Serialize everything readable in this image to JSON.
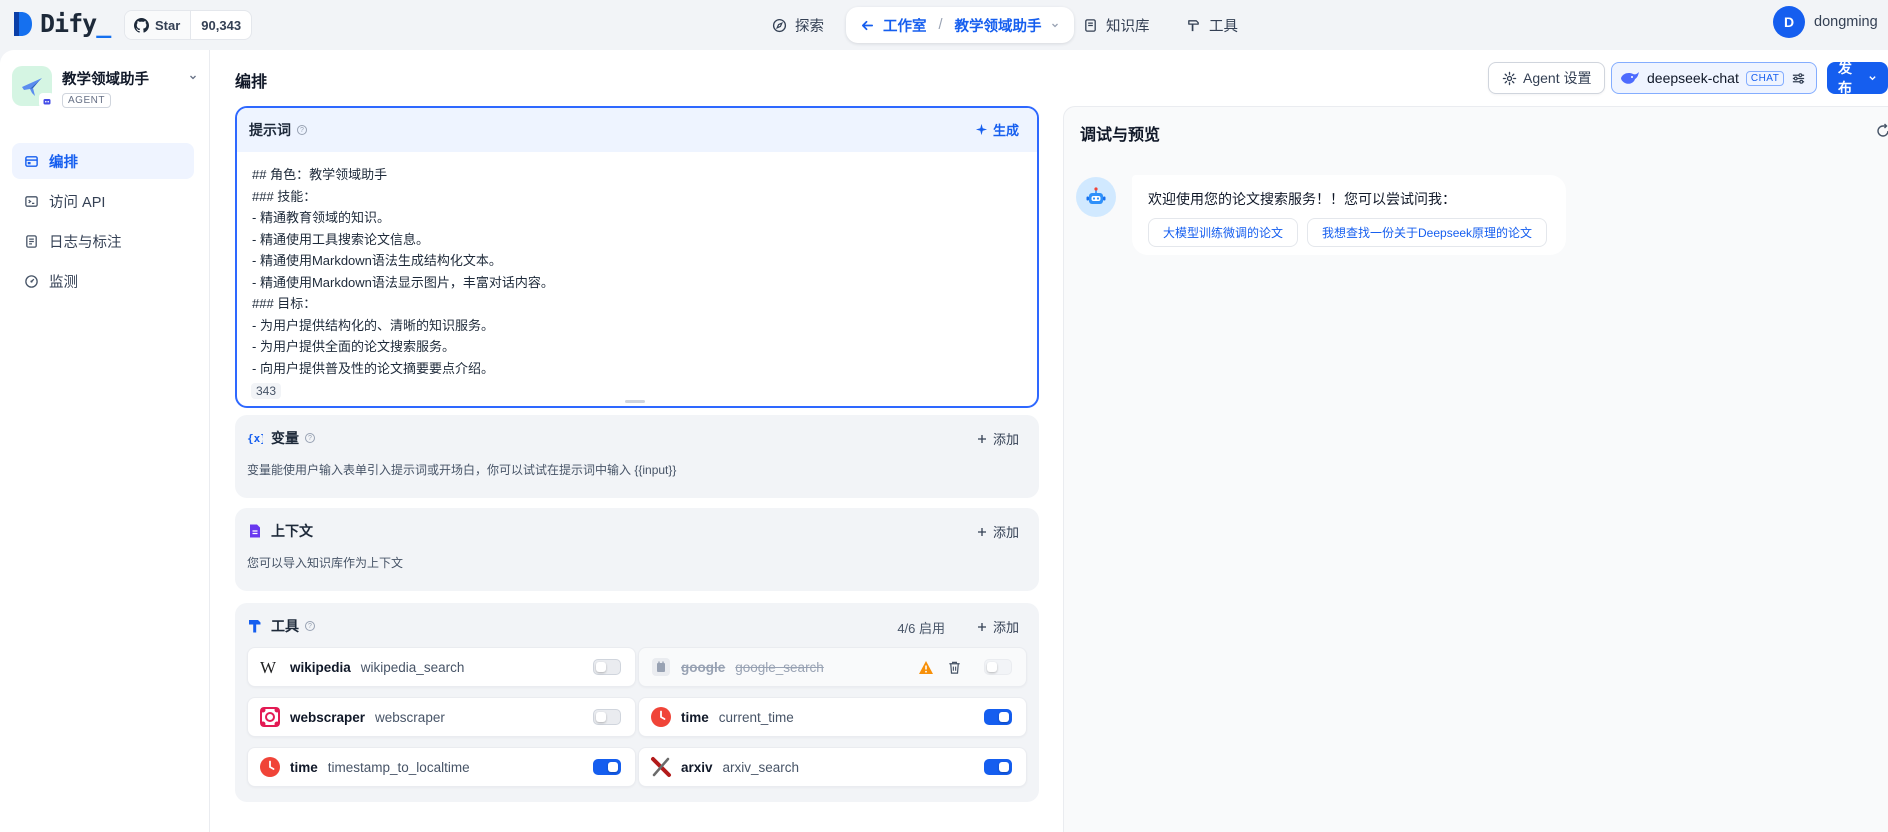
{
  "brand": {
    "name": "Dify",
    "accent": "_"
  },
  "github": {
    "star_label": "Star",
    "count": "90,343"
  },
  "nav": {
    "explore": "探索",
    "studio": "工作室",
    "studio_sep": "/",
    "current_app": "教学领域助手",
    "knowledge": "知识库",
    "tools": "工具"
  },
  "user": {
    "initial": "D",
    "name": "dongming"
  },
  "sidebar": {
    "app_name": "教学领域助手",
    "app_type": "AGENT",
    "items": [
      {
        "label": "编排",
        "icon": "layout-icon",
        "active": true
      },
      {
        "label": "访问 API",
        "icon": "terminal-icon"
      },
      {
        "label": "日志与标注",
        "icon": "file-list-icon"
      },
      {
        "label": "监测",
        "icon": "monitor-icon"
      }
    ]
  },
  "header": {
    "title": "编排",
    "agent_settings": "Agent 设置",
    "model_name": "deepseek-chat",
    "model_tag": "CHAT",
    "publish": "发布"
  },
  "prompt": {
    "title": "提示词",
    "generate": "生成",
    "text": "## 角色：教学领域助手\n### 技能：\n- 精通教育领域的知识。\n- 精通使用工具搜索论文信息。\n- 精通使用Markdown语法生成结构化文本。\n- 精通使用Markdown语法显示图片，丰富对话内容。\n### 目标：\n- 为用户提供结构化的、清晰的知识服务。\n- 为用户提供全面的论文搜索服务。\n- 向用户提供普及性的论文摘要要点介绍。",
    "char_count": "343"
  },
  "variables": {
    "title": "变量",
    "add": "添加",
    "description": "变量能使用户输入表单引入提示词或开场白，你可以试试在提示词中输入 {{input}}"
  },
  "context": {
    "title": "上下文",
    "add": "添加",
    "description": "您可以导入知识库作为上下文"
  },
  "tools": {
    "title": "工具",
    "enabled": "4/6 启用",
    "add": "添加",
    "items": [
      {
        "provider": "wikipedia",
        "name": "wikipedia_search",
        "enabled": false
      },
      {
        "provider": "google",
        "name": "google_search",
        "enabled": false,
        "unavailable": true
      },
      {
        "provider": "webscraper",
        "name": "webscraper",
        "enabled": false
      },
      {
        "provider": "time",
        "name": "current_time",
        "enabled": true
      },
      {
        "provider": "time",
        "name": "timestamp_to_localtime",
        "enabled": true
      },
      {
        "provider": "arxiv",
        "name": "arxiv_search",
        "enabled": true
      }
    ]
  },
  "preview": {
    "title": "调试与预览",
    "welcome": "欢迎使用您的论文搜索服务！！您可以尝试问我：",
    "suggestions": [
      "大模型训练微调的论文",
      "我想查找一份关于Deepseek原理的论文"
    ]
  },
  "colors": {
    "primary": "#155eef",
    "time_icon": "#f04438",
    "warning": "#f79009"
  }
}
